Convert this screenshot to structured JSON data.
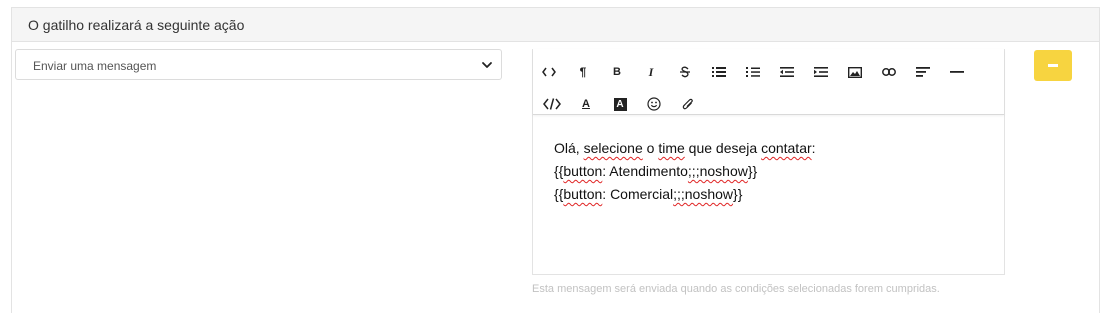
{
  "header": {
    "title": "O gatilho realizará a seguinte ação"
  },
  "action_select": {
    "selected": "Enviar uma mensagem"
  },
  "toolbar": {
    "row1": [
      "code-view-icon",
      "paragraph-icon",
      "bold-icon",
      "italic-icon",
      "strikethrough-icon",
      "bulleted-list-icon",
      "numbered-list-icon",
      "outdent-icon",
      "indent-icon",
      "image-icon",
      "link-icon",
      "align-icon",
      "horizontal-rule-icon"
    ],
    "row2": [
      "code-icon",
      "font-color-icon",
      "background-color-icon",
      "emoji-icon",
      "attachment-icon"
    ],
    "labels": {
      "paragraph": "¶",
      "bold": "B",
      "italic": "I",
      "font_color": "A",
      "bg_color": "A"
    }
  },
  "editor": {
    "lines": [
      [
        "Olá, ",
        "selecione",
        " o ",
        "time",
        " que deseja ",
        "contatar",
        ":"
      ],
      [
        "{{",
        "button",
        ": Atendimento",
        ";;;noshow",
        "}}"
      ],
      [
        "{{",
        "button",
        ": Comercial",
        ";;;noshow",
        "}}"
      ]
    ]
  },
  "hint": "Esta mensagem será enviada quando as condições selecionadas forem cumpridas.",
  "colors": {
    "accent": "#f7d440",
    "header_bg": "#f5f5f5",
    "spell": "#e02424"
  }
}
